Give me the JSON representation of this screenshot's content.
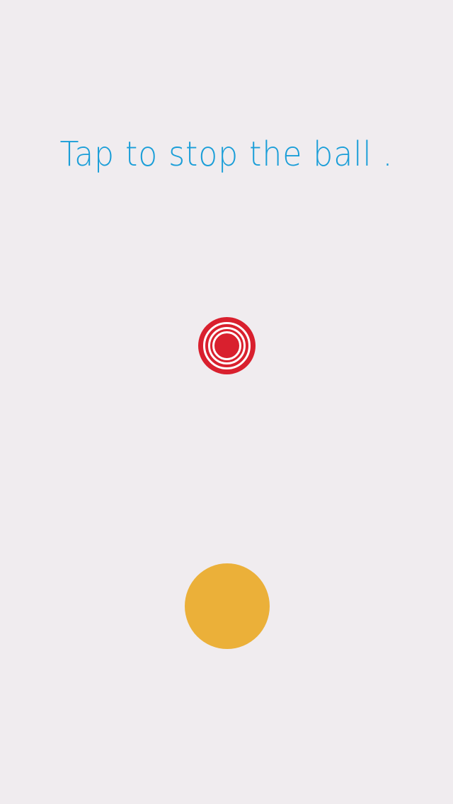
{
  "instruction": {
    "text": "Tap to stop the ball .",
    "color": "#1a9ed8"
  },
  "target": {
    "icon": "bullseye-target-icon",
    "color": "#d9202e",
    "ring_color": "#ffffff"
  },
  "ball": {
    "color": "#ebb039"
  },
  "background_color": "#f0ecef"
}
